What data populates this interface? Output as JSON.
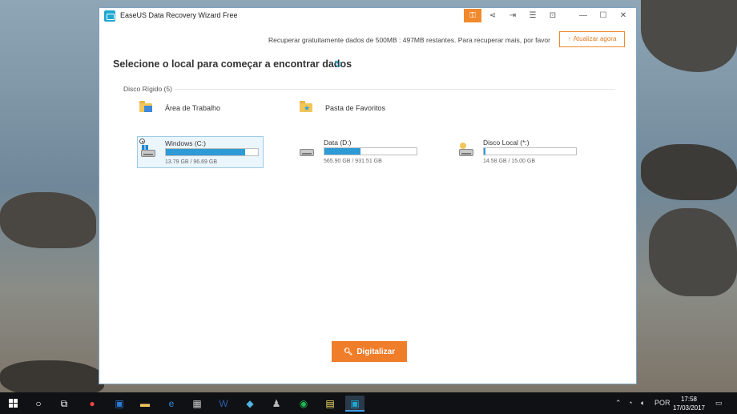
{
  "window": {
    "title": "EaseUS Data Recovery Wizard Free",
    "controls": [
      "key-icon",
      "share-icon",
      "sign-in-icon",
      "menu-icon",
      "dropdown-icon",
      "minimize-icon",
      "maximize-icon",
      "close-icon"
    ]
  },
  "promo": {
    "text": "Recuperar gratuitamente dados de 500MB :  497MB restantes. Para recuperar mais, por favor",
    "update_label": "Atualizar agora"
  },
  "main": {
    "heading": "Selecione o local para começar a encontrar dados",
    "section_label": "Disco Rígido (5)",
    "locations": [
      {
        "label": "Área de Trabalho",
        "icon": "desktop-folder-icon"
      },
      {
        "label": "Pasta de Favoritos",
        "icon": "favorites-folder-icon"
      }
    ],
    "drives": [
      {
        "name": "Windows (C:)",
        "size": "13.79 GB / 96.69 GB",
        "used_fraction": 0.86,
        "selected": true
      },
      {
        "name": "Data (D:)",
        "size": "565.90 GB / 931.51 GB",
        "used_fraction": 0.39,
        "selected": false
      },
      {
        "name": "Disco Local (*:)",
        "size": "14.58 GB / 15.00 GB",
        "used_fraction": 0.02,
        "selected": false
      }
    ],
    "scan_label": "Digitalizar"
  },
  "taskbar": {
    "language": "POR",
    "time": "17:58",
    "date": "17/03/2017"
  },
  "colors": {
    "accent_orange": "#f07d2a",
    "bar_blue": "#2e9ad6"
  }
}
